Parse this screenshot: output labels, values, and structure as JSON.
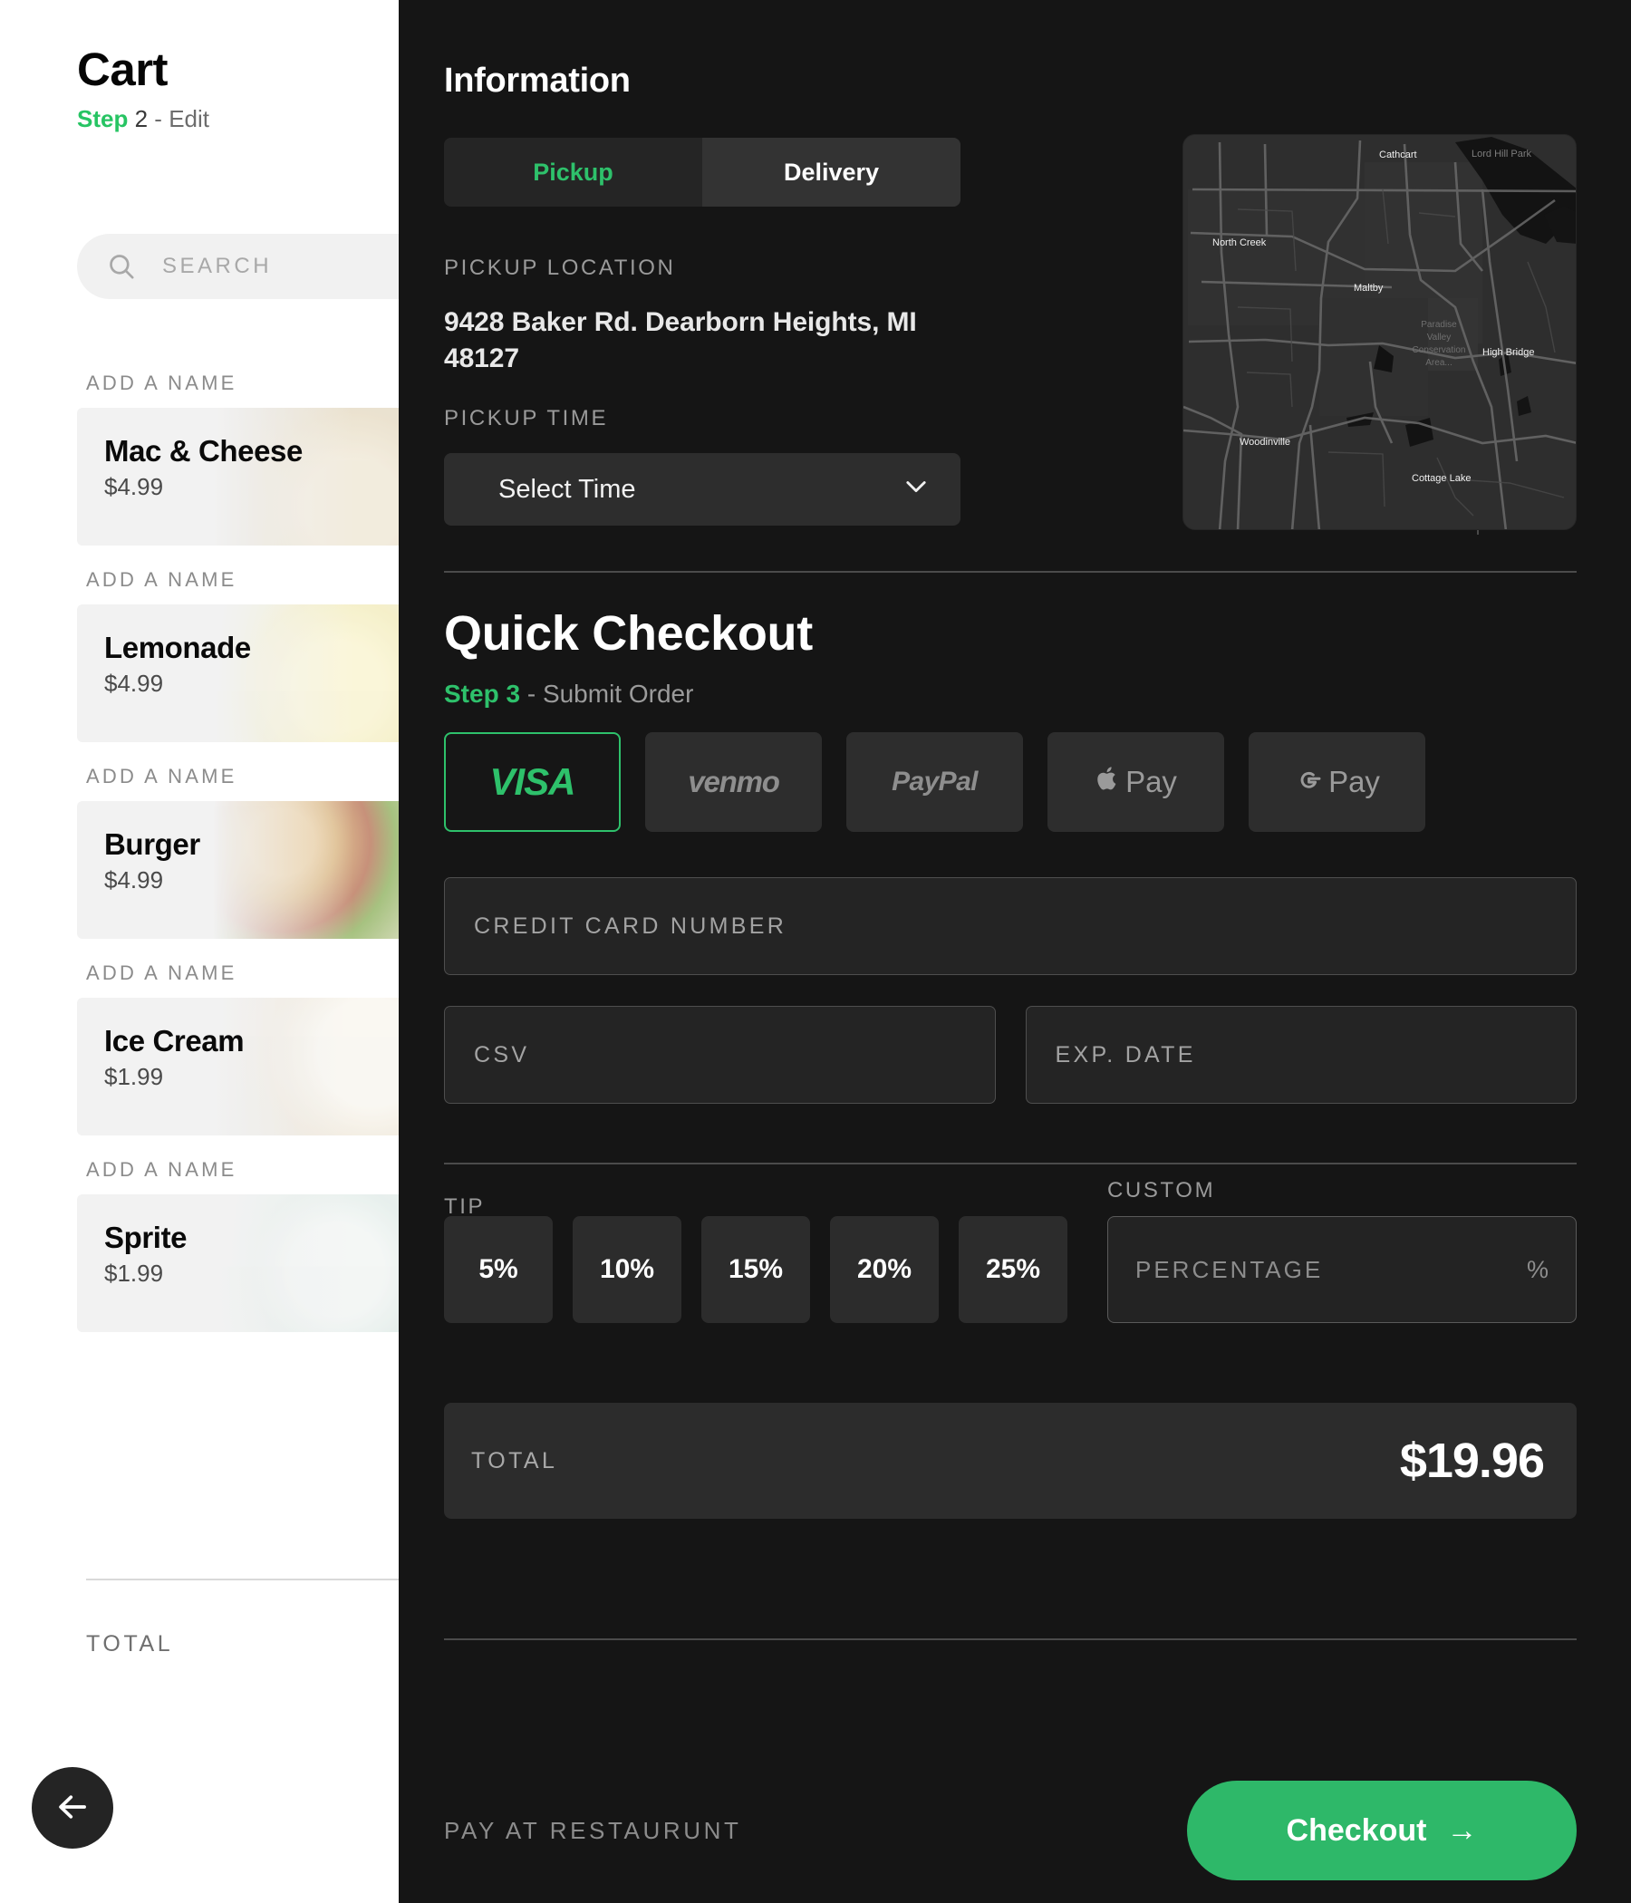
{
  "cart": {
    "title": "Cart",
    "step_label": "Step",
    "step_number": "2",
    "step_sep": "-",
    "step_action": "Edit",
    "search_placeholder": "SEARCH",
    "add_name_label": "ADD A NAME",
    "items": [
      {
        "name": "Mac & Cheese",
        "price": "$4.99",
        "photo": "ph-mac"
      },
      {
        "name": "Lemonade",
        "price": "$4.99",
        "photo": "ph-lem"
      },
      {
        "name": "Burger",
        "price": "$4.99",
        "photo": "ph-bur"
      },
      {
        "name": "Ice Cream",
        "price": "$1.99",
        "photo": "ph-ice"
      },
      {
        "name": "Sprite",
        "price": "$1.99",
        "photo": "ph_spr"
      }
    ],
    "total_label": "TOTAL"
  },
  "information": {
    "heading": "Information",
    "tabs": {
      "pickup": "Pickup",
      "delivery": "Delivery"
    },
    "pickup_location_label": "PICKUP LOCATION",
    "pickup_location_value": "9428 Baker Rd. Dearborn Heights, MI 48127",
    "pickup_time_label": "PICKUP TIME",
    "select_time_value": "Select Time",
    "map_labels": [
      "Cathcart",
      "Lord Hill Park",
      "North Creek",
      "Maltby",
      "Paradise Valley Conservation Area...",
      "High Bridge",
      "Woodinville",
      "Cottage Lake"
    ]
  },
  "checkout": {
    "heading": "Quick Checkout",
    "step_label": "Step",
    "step_number": "3",
    "step_sep": "-",
    "step_action": "Submit Order",
    "payment_methods": [
      {
        "id": "visa",
        "label": "VISA",
        "selected": true
      },
      {
        "id": "venmo",
        "label": "venmo",
        "selected": false
      },
      {
        "id": "paypal",
        "label": "PayPal",
        "selected": false
      },
      {
        "id": "applepay",
        "label": "Pay",
        "selected": false
      },
      {
        "id": "gpay",
        "label": "Pay",
        "selected": false
      }
    ],
    "card_number_placeholder": "CREDIT CARD NUMBER",
    "csv_placeholder": "CSV",
    "exp_date_placeholder": "EXP. DATE",
    "tip_label": "TIP",
    "tip_options": [
      "5%",
      "10%",
      "15%",
      "20%",
      "25%"
    ],
    "custom_label": "CUSTOM",
    "custom_placeholder": "PERCENTAGE",
    "percent_symbol": "%",
    "total_label": "TOTAL",
    "total_amount": "$19.96",
    "pay_at_restaurant": "PAY AT RESTAURUNT",
    "checkout_button": "Checkout",
    "checkout_arrow": "→"
  },
  "colors": {
    "accent_green": "#2ec16b",
    "button_green": "#2eb869",
    "panel_dark": "#151515",
    "panel_light": "#ffffff"
  }
}
